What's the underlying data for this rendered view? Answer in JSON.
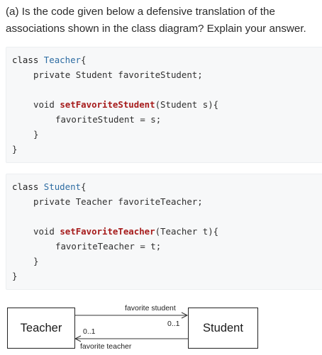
{
  "question": {
    "text": "(a) Is the code given below a defensive translation of the associations shown in the class diagram? Explain your answer."
  },
  "code_blocks": [
    {
      "class_keyword": "class",
      "class_name": "Teacher",
      "open_brace": "{",
      "field_modifier": "private",
      "field_type": "Student",
      "field_name": "favoriteStudent;",
      "method_return": "void",
      "method_name": "setFavoriteStudent",
      "method_params": "(Student s){",
      "method_body": "favoriteStudent = s;",
      "method_close": "}",
      "class_close": "}"
    },
    {
      "class_keyword": "class",
      "class_name": "Student",
      "open_brace": "{",
      "field_modifier": "private",
      "field_type": "Teacher",
      "field_name": "favoriteTeacher;",
      "method_return": "void",
      "method_name": "setFavoriteTeacher",
      "method_params": "(Teacher t){",
      "method_body": "favoriteTeacher = t;",
      "method_close": "}",
      "class_close": "}"
    }
  ],
  "diagram": {
    "left_class": "Teacher",
    "right_class": "Student",
    "top_role": "favorite student",
    "top_multiplicity": "0..1",
    "bottom_role": "favorite teacher",
    "bottom_multiplicity": "0..1"
  }
}
